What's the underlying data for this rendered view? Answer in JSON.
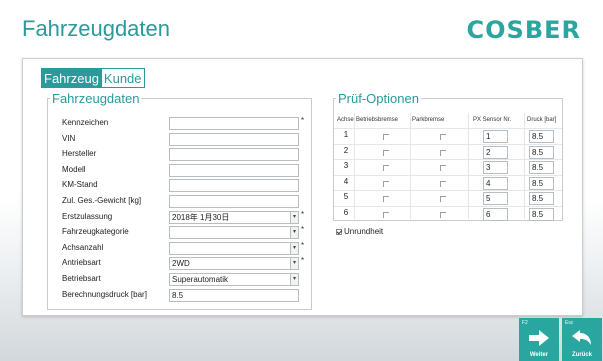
{
  "header": {
    "title": "Fahrzeugdaten",
    "logo_text": "COSBER"
  },
  "tabs": [
    {
      "label": "Fahrzeug",
      "active": true
    },
    {
      "label": "Kunde",
      "active": false
    }
  ],
  "vehicle": {
    "legend": "Fahrzeugdaten",
    "fields": [
      {
        "label": "Kennzeichen",
        "value": "",
        "required": true,
        "type": "text"
      },
      {
        "label": "VIN",
        "value": "",
        "required": false,
        "type": "text"
      },
      {
        "label": "Hersteller",
        "value": "",
        "required": false,
        "type": "text"
      },
      {
        "label": "Modell",
        "value": "",
        "required": false,
        "type": "text"
      },
      {
        "label": "KM-Stand",
        "value": "",
        "required": false,
        "type": "text"
      },
      {
        "label": "Zul. Ges.-Gewicht [kg]",
        "value": "",
        "required": false,
        "type": "text"
      },
      {
        "label": "Erstzulassung",
        "value": "2018年 1月30日",
        "required": true,
        "type": "select"
      },
      {
        "label": "Fahrzeugkategorie",
        "value": "",
        "required": true,
        "type": "select"
      },
      {
        "label": "Achsanzahl",
        "value": "",
        "required": true,
        "type": "select"
      },
      {
        "label": "Antriebsart",
        "value": "2WD",
        "required": true,
        "type": "select"
      },
      {
        "label": "Betriebsart",
        "value": "Superautomatik",
        "required": false,
        "type": "select"
      },
      {
        "label": "Berechnungsdruck [bar]",
        "value": "8.5",
        "required": false,
        "type": "text"
      }
    ],
    "required_mark": "*"
  },
  "pruef": {
    "legend": "Prüf-Optionen",
    "headers": [
      "Achse",
      "Betriebsbremse",
      "Parkbremse",
      "PX Sensor Nr.",
      "Druck [bar]"
    ],
    "rows": [
      {
        "achse": "1",
        "sensor": "1",
        "druck": "8.5"
      },
      {
        "achse": "2",
        "sensor": "2",
        "druck": "8.5"
      },
      {
        "achse": "3",
        "sensor": "3",
        "druck": "8.5"
      },
      {
        "achse": "4",
        "sensor": "4",
        "druck": "8.5"
      },
      {
        "achse": "5",
        "sensor": "5",
        "druck": "8.5"
      },
      {
        "achse": "6",
        "sensor": "6",
        "druck": "8.5"
      }
    ],
    "unrundheit_label": "Unrundheit",
    "unrundheit_checked": true
  },
  "nav": {
    "weiter": {
      "key": "F2",
      "label": "Weiter",
      "icon": "arrow-right-icon"
    },
    "zurueck": {
      "key": "Esc",
      "label": "Zurück",
      "icon": "arrow-back-icon"
    }
  },
  "colors": {
    "accent": "#2a9a9a",
    "button": "#2aa6a0"
  }
}
